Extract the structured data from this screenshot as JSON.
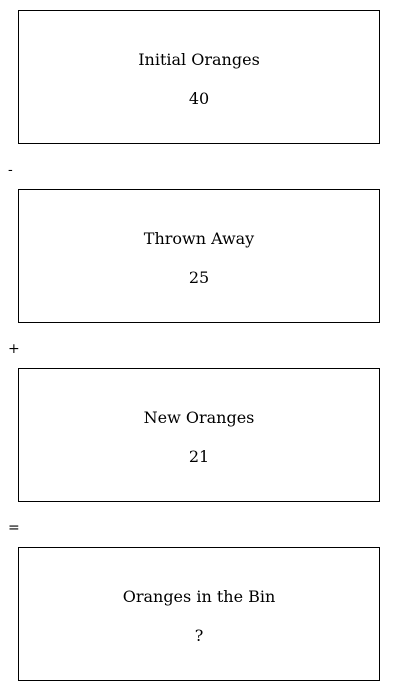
{
  "boxes": [
    {
      "label": "Initial Oranges",
      "value": "40"
    },
    {
      "label": "Thrown Away",
      "value": "25"
    },
    {
      "label": "New Oranges",
      "value": "21"
    },
    {
      "label": "Oranges in the Bin",
      "value": "?"
    }
  ],
  "operators": [
    "-",
    "+",
    "="
  ]
}
